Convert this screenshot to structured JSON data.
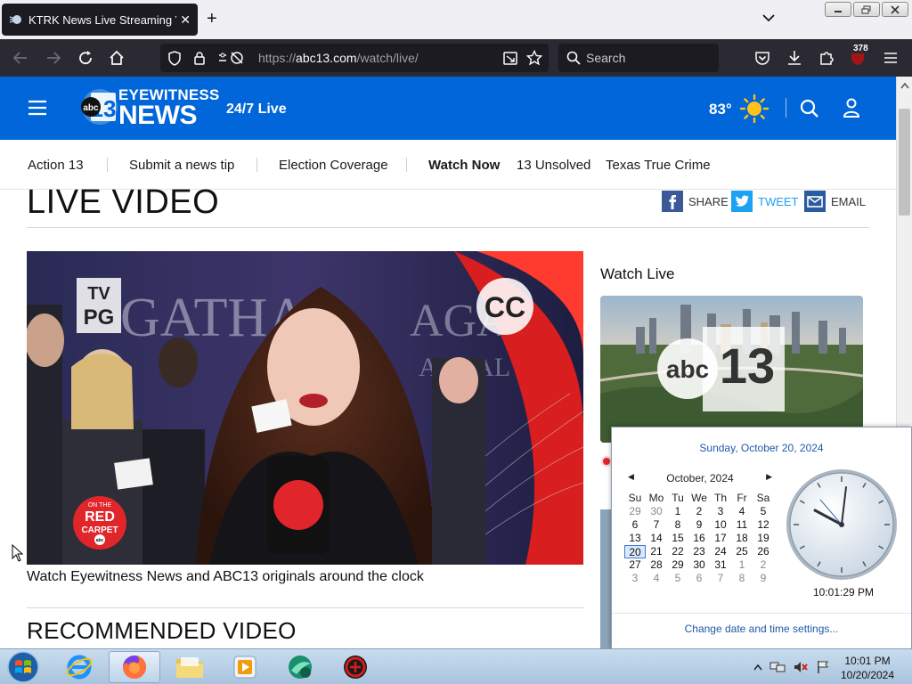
{
  "browser": {
    "tab_title": "KTRK News Live Streaming Vide",
    "url_scheme": "https://",
    "url_host": "abc13.com",
    "url_path": "/watch/live/",
    "search_placeholder": "Search",
    "extension_badge": "378"
  },
  "site": {
    "logo_eyewitness": "EYEWITNESS",
    "logo_news": "NEWS",
    "logo_abc": "abc",
    "logo_13": "13",
    "live_label": "24/7 Live",
    "temperature": "83°"
  },
  "nav": {
    "items": [
      "Action 13",
      "Submit a news tip",
      "Election Coverage",
      "Watch Now",
      "13 Unsolved",
      "Texas True Crime"
    ]
  },
  "page": {
    "title": "LIVE VIDEO",
    "share_label": "SHARE",
    "tweet_label": "TWEET",
    "email_label": "EMAIL",
    "video_caption": "Watch Eyewitness News and ABC13 originals around the clock",
    "recommended_title": "RECOMMENDED VIDEO",
    "watch_live_heading": "Watch Live"
  },
  "video_overlay": {
    "rating_line1": "TV",
    "rating_line2": "PG",
    "cc": "CC",
    "bg_text_left": "GATHA",
    "bg_text_right": "AGA",
    "bg_text_right2": "ALL AL",
    "badge_top": "ON THE",
    "badge_red": "RED",
    "badge_carpet": "CARPET",
    "badge_abc": "abc"
  },
  "calendar": {
    "full_date": "Sunday, October 20, 2024",
    "month_label": "October, 2024",
    "weekdays": [
      "Su",
      "Mo",
      "Tu",
      "We",
      "Th",
      "Fr",
      "Sa"
    ],
    "days": [
      {
        "d": "29",
        "dim": true
      },
      {
        "d": "30",
        "dim": true
      },
      {
        "d": "1"
      },
      {
        "d": "2"
      },
      {
        "d": "3"
      },
      {
        "d": "4"
      },
      {
        "d": "5"
      },
      {
        "d": "6"
      },
      {
        "d": "7"
      },
      {
        "d": "8"
      },
      {
        "d": "9"
      },
      {
        "d": "10"
      },
      {
        "d": "11"
      },
      {
        "d": "12"
      },
      {
        "d": "13"
      },
      {
        "d": "14"
      },
      {
        "d": "15"
      },
      {
        "d": "16"
      },
      {
        "d": "17"
      },
      {
        "d": "18"
      },
      {
        "d": "19"
      },
      {
        "d": "20",
        "today": true
      },
      {
        "d": "21"
      },
      {
        "d": "22"
      },
      {
        "d": "23"
      },
      {
        "d": "24"
      },
      {
        "d": "25"
      },
      {
        "d": "26"
      },
      {
        "d": "27"
      },
      {
        "d": "28"
      },
      {
        "d": "29"
      },
      {
        "d": "30"
      },
      {
        "d": "31"
      },
      {
        "d": "1",
        "dim": true
      },
      {
        "d": "2",
        "dim": true
      },
      {
        "d": "3",
        "dim": true
      },
      {
        "d": "4",
        "dim": true
      },
      {
        "d": "5",
        "dim": true
      },
      {
        "d": "6",
        "dim": true
      },
      {
        "d": "7",
        "dim": true
      },
      {
        "d": "8",
        "dim": true
      },
      {
        "d": "9",
        "dim": true
      }
    ],
    "clock_time": "10:01:29 PM",
    "settings_link": "Change date and time settings..."
  },
  "taskbar": {
    "time": "10:01 PM",
    "date": "10/20/2024"
  },
  "colors": {
    "brand_blue": "#0066d9",
    "facebook": "#3b5998",
    "twitter": "#1da1f2",
    "live_red": "#e0252b"
  },
  "icons": {
    "weather": "sun-icon",
    "search": "search-icon",
    "account": "user-icon",
    "menu": "hamburger-icon"
  }
}
